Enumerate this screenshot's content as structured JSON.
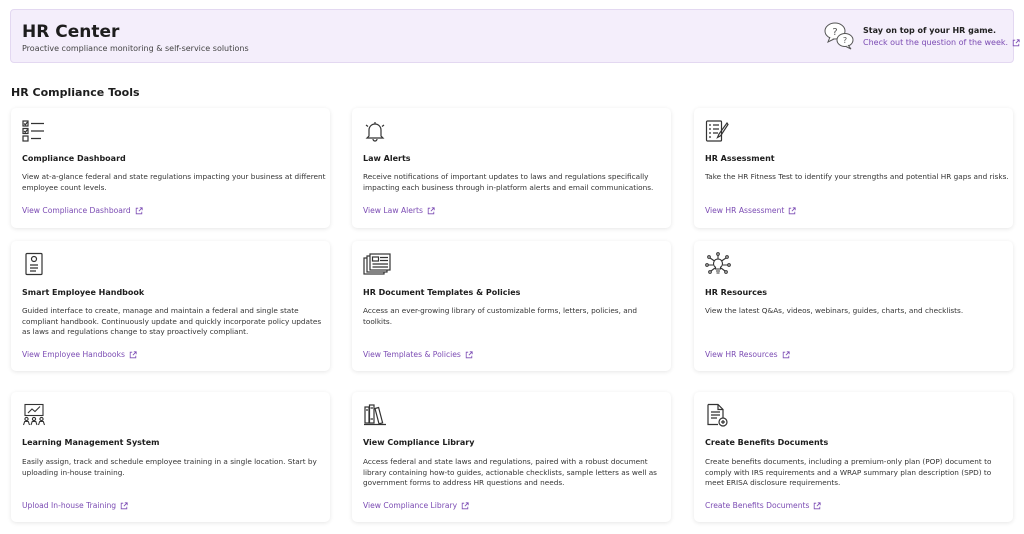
{
  "header": {
    "title": "HR Center",
    "subtitle": "Proactive compliance monitoring & self-service solutions",
    "promo_heading": "Stay on top of your HR game.",
    "promo_link": "Check out the question of the week."
  },
  "section_title": "HR Compliance Tools",
  "colors": {
    "accent": "#7b4bb3",
    "header_bg": "#f4eefb"
  },
  "cards": [
    {
      "icon": "checklist-icon",
      "title": "Compliance Dashboard",
      "description": "View at-a-glance federal and state regulations impacting your business at different employee count levels.",
      "link": "View Compliance Dashboard"
    },
    {
      "icon": "bell-icon",
      "title": "Law Alerts",
      "description": "Receive notifications of important updates to laws and regulations specifically impacting each business through in-platform alerts and email communications.",
      "link": "View Law Alerts"
    },
    {
      "icon": "assessment-icon",
      "title": "HR Assessment",
      "description": "Take the HR Fitness Test to identify your strengths and potential HR gaps and risks.",
      "link": "View HR Assessment"
    },
    {
      "icon": "handbook-icon",
      "title": "Smart Employee Handbook",
      "description": "Guided interface to create, manage and maintain a federal and single state compliant handbook. Continuously update and quickly incorporate policy updates as laws and regulations change to stay proactively compliant.",
      "link": "View Employee Handbooks"
    },
    {
      "icon": "templates-icon",
      "title": "HR Document Templates & Policies",
      "description": "Access an ever-growing library of customizable forms, letters, policies, and toolkits.",
      "link": "View Templates & Policies"
    },
    {
      "icon": "network-bulb-icon",
      "title": "HR Resources",
      "description": "View the latest Q&As, videos, webinars, guides, charts, and checklists.",
      "link": "View HR Resources"
    },
    {
      "icon": "training-icon",
      "title": "Learning Management System",
      "description": "Easily assign, track and schedule employee training in a single location. Start by uploading in-house training.",
      "link": "Upload In-house Training"
    },
    {
      "icon": "library-icon",
      "title": "View Compliance Library",
      "description": "Access federal and state laws and regulations, paired with a robust document library containing how-to guides, actionable checklists, sample letters as well as government forms to address HR questions and needs.",
      "link": "View Compliance Library"
    },
    {
      "icon": "document-plus-icon",
      "title": "Create Benefits Documents",
      "description": "Create benefits documents, including a premium-only plan (POP) document to comply with IRS requirements and a WRAP summary plan description (SPD) to meet ERISA disclosure requirements.",
      "link": "Create Benefits Documents"
    }
  ]
}
